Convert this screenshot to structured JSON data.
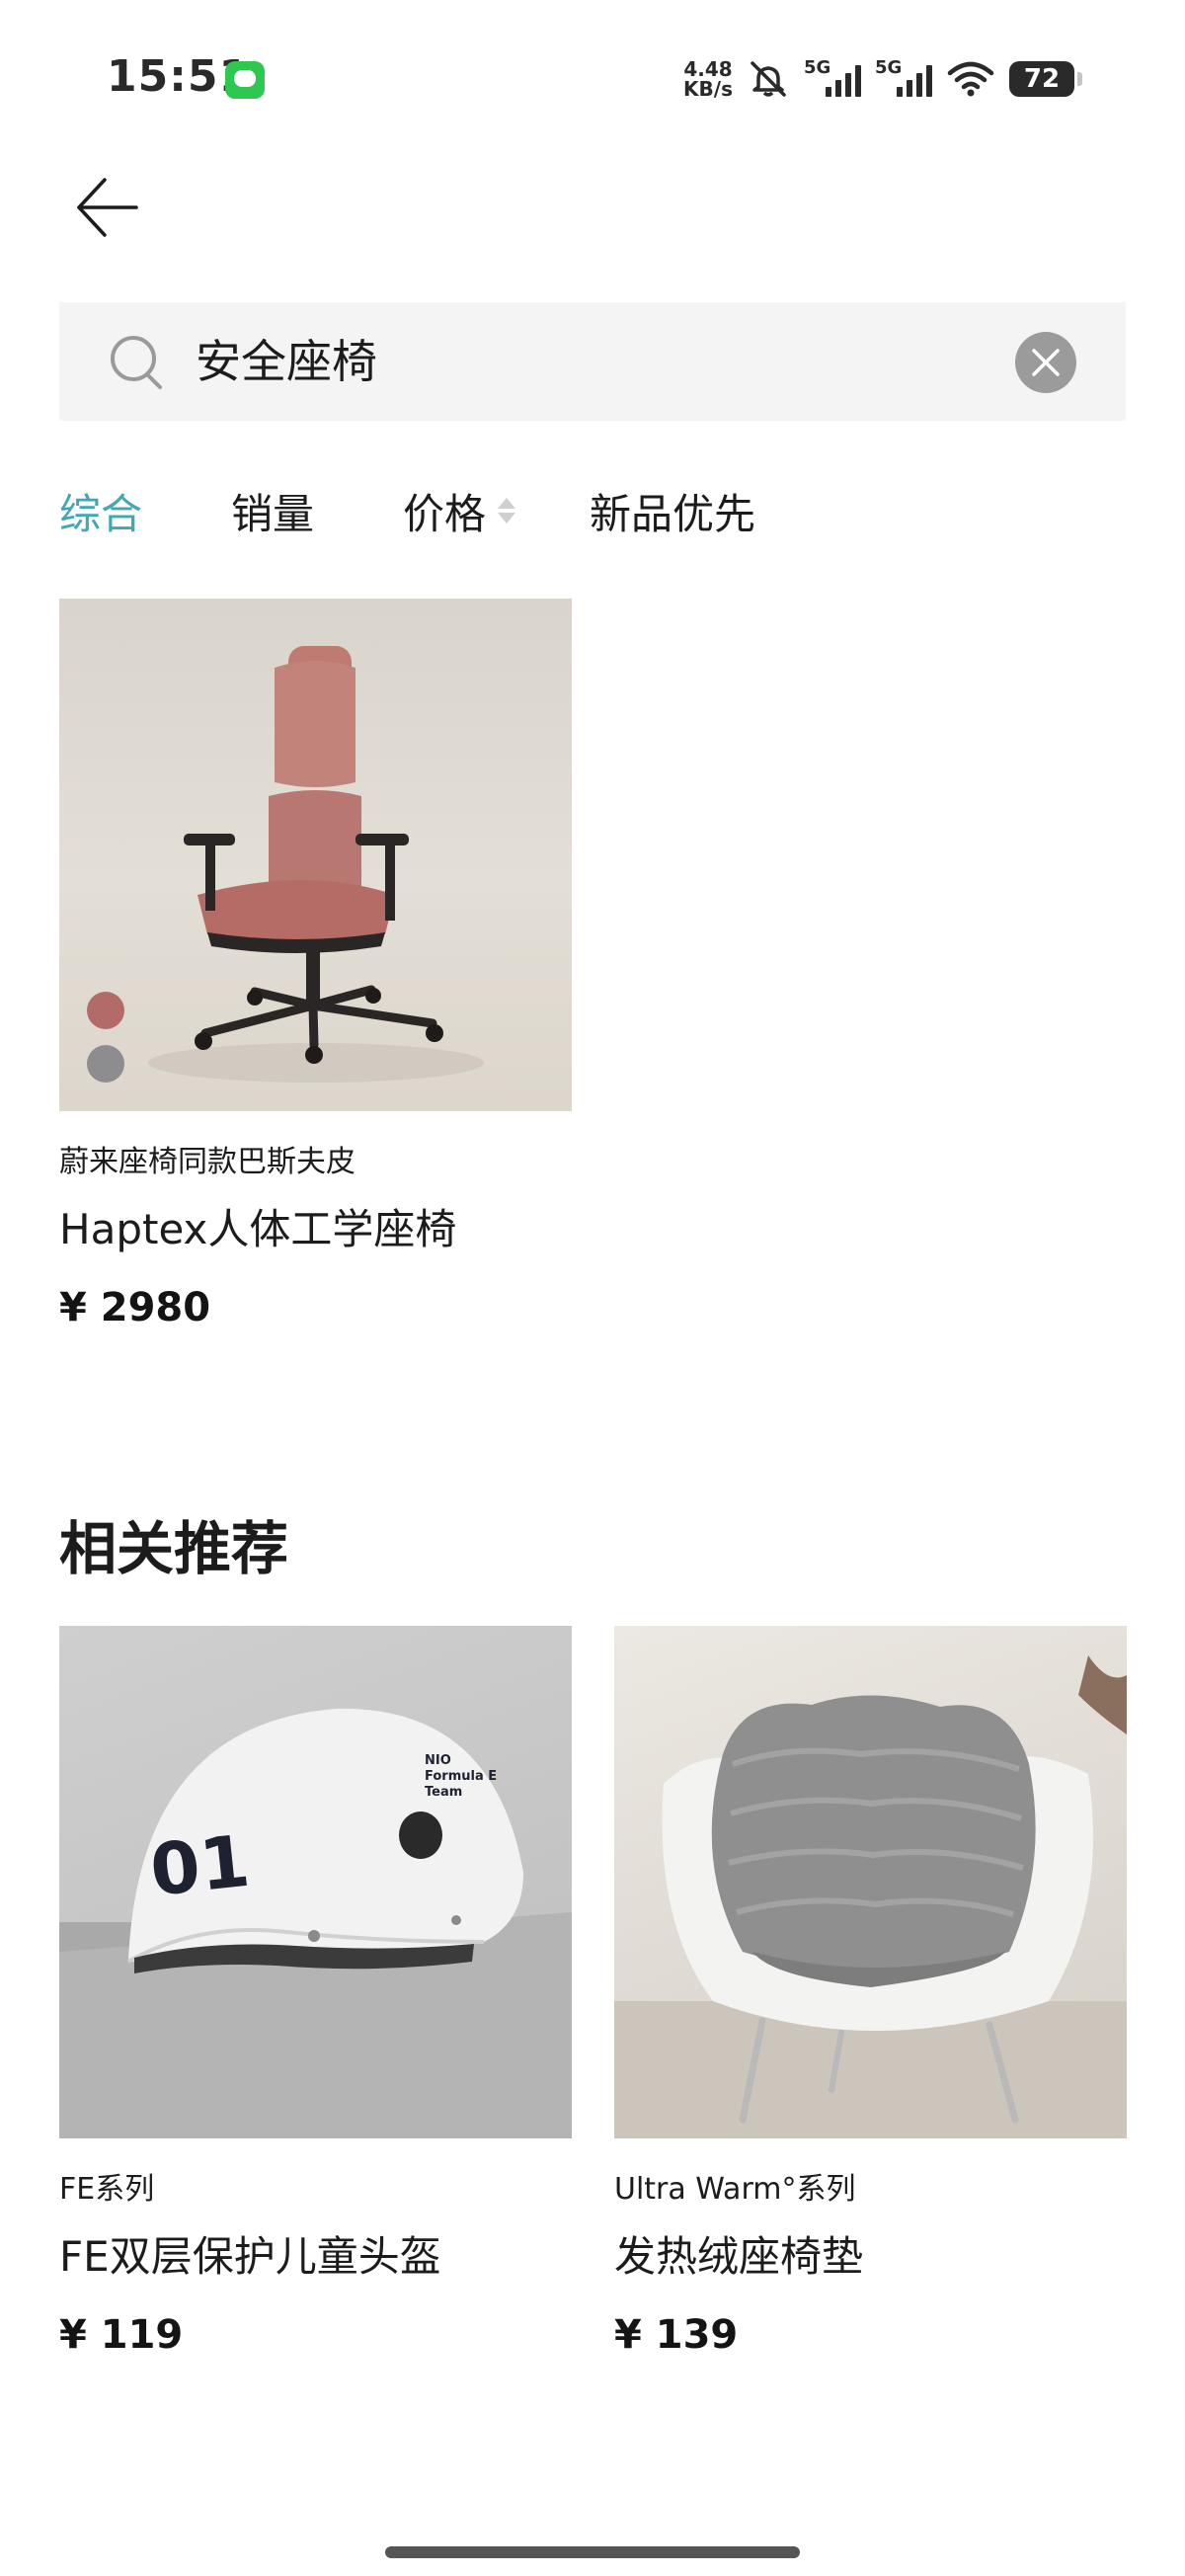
{
  "status_bar": {
    "time": "15:51",
    "net_speed_value": "4.48",
    "net_speed_unit": "KB/s",
    "signal_1_label": "5G",
    "signal_2_label": "5G",
    "battery_level": "72"
  },
  "search": {
    "query": "安全座椅"
  },
  "tabs": [
    {
      "label": "综合",
      "active": true
    },
    {
      "label": "销量",
      "active": false
    },
    {
      "label": "价格",
      "active": false
    },
    {
      "label": "新品优先",
      "active": false
    }
  ],
  "results": [
    {
      "series": "蔚来座椅同款巴斯夫皮",
      "name": "Haptex人体工学座椅",
      "price": "¥ 2980",
      "color_options": [
        "#b36b68",
        "#8d8d8f"
      ]
    }
  ],
  "recommendations": {
    "title": "相关推荐",
    "items": [
      {
        "series": "FE系列",
        "name": "FE双层保护儿童头盔",
        "price": "¥ 119"
      },
      {
        "series": "Ultra Warm°系列",
        "name": "发热绒座椅垫",
        "price": "¥ 139"
      }
    ]
  },
  "colors": {
    "accent": "#3fa8b3",
    "search_bg": "#f4f4f4",
    "clear_button": "#9b9b9b"
  },
  "icons": {
    "back": "arrow-left-icon",
    "search": "search-icon",
    "clear": "close-icon",
    "sort": "sort-icon"
  }
}
